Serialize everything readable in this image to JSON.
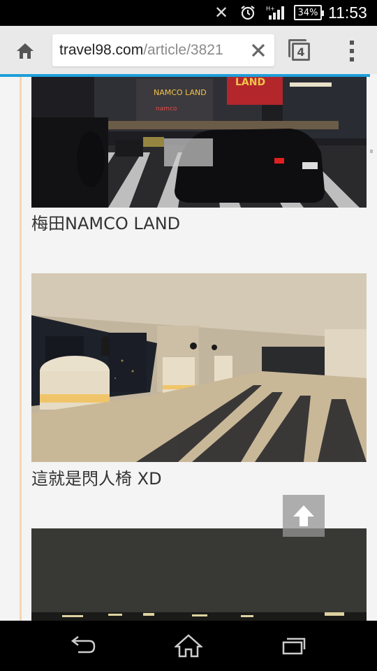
{
  "status_bar": {
    "time": "11:53",
    "battery_level": "34%",
    "icons": [
      "nfc-icon",
      "alarm-icon",
      "hplus-signal-icon",
      "battery-icon"
    ]
  },
  "browser": {
    "url_domain": "travel98.com",
    "url_path": "/article/3821",
    "tab_count": "4",
    "accent_color": "#1e9ed9"
  },
  "article": {
    "items": [
      {
        "caption": "梅田NAMCO LAND",
        "image": "night-street-namco-land-photo"
      },
      {
        "caption": "這就是閃人椅 XD",
        "image": "observation-deck-lobby-photo"
      },
      {
        "caption": "",
        "image": "night-city-skyline-photo"
      }
    ]
  },
  "navigation": {
    "buttons": [
      "back-icon",
      "home-icon",
      "recent-apps-icon"
    ]
  }
}
